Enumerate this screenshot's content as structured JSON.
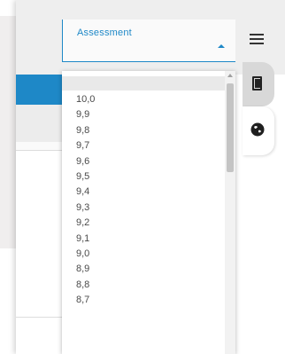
{
  "assessment": {
    "label": "Assessment",
    "options": [
      "10,0",
      "9,9",
      "9,8",
      "9,7",
      "9,6",
      "9,5",
      "9,4",
      "9,3",
      "9,2",
      "9,1",
      "9,0",
      "8,9",
      "8,8",
      "8,7"
    ]
  },
  "icons": [
    "menu-icon",
    "document-icon",
    "globe-icon"
  ],
  "colors": {
    "accent": "#1e88c7",
    "panel_bg": "#f0eeee"
  }
}
